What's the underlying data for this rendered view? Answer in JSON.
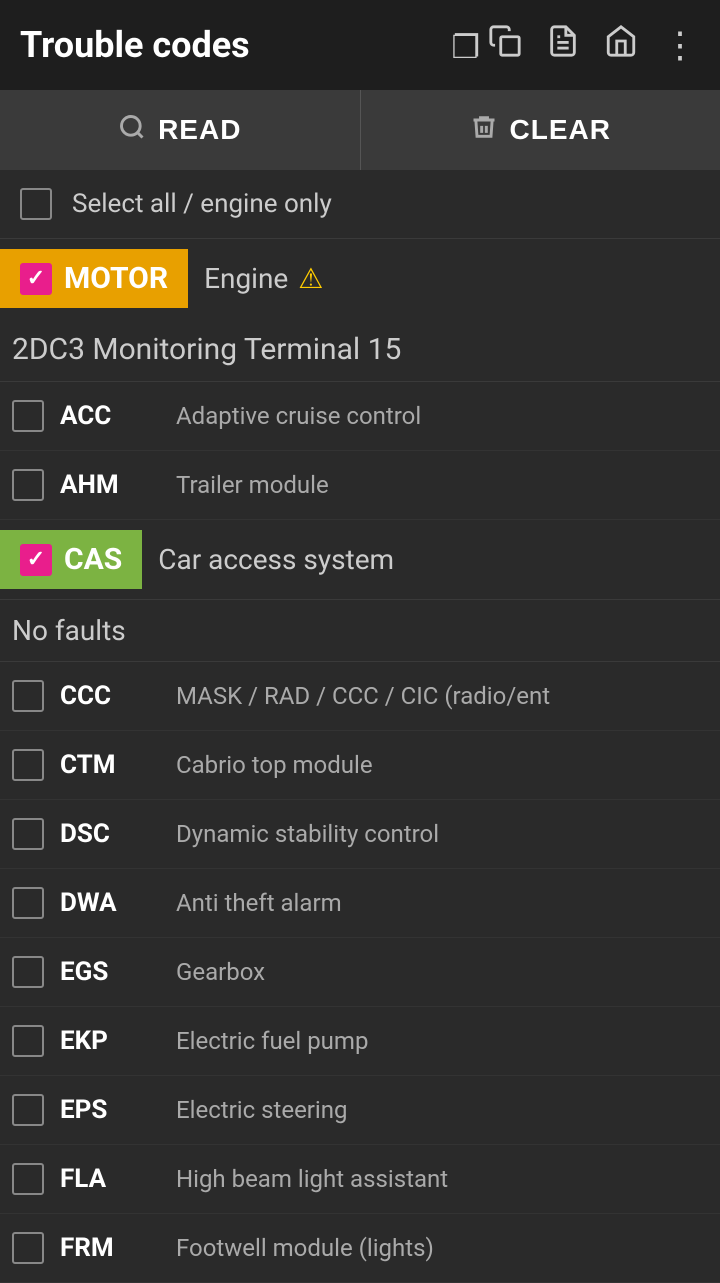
{
  "header": {
    "title": "Trouble codes",
    "icons": [
      "copy",
      "document",
      "home",
      "more"
    ]
  },
  "actions": {
    "read_label": "READ",
    "clear_label": "CLEAR"
  },
  "select_all": {
    "label": "Select all / engine only",
    "checked": false
  },
  "modules": [
    {
      "tag": "MOTOR",
      "type": "motor",
      "checked": true,
      "description": "Engine",
      "has_warning": true,
      "monitor_header": "2DC3 Monitoring Terminal 15",
      "items": [
        {
          "code": "ACC",
          "desc": "Adaptive cruise control",
          "checked": false
        },
        {
          "code": "AHM",
          "desc": "Trailer module",
          "checked": false
        }
      ]
    },
    {
      "tag": "CAS",
      "type": "cas",
      "checked": true,
      "description": "Car access system",
      "has_warning": false,
      "no_faults": "No faults",
      "items": [
        {
          "code": "CCC",
          "desc": "MASK / RAD / CCC / CIC (radio/ent",
          "checked": false
        },
        {
          "code": "CTM",
          "desc": "Cabrio top module",
          "checked": false
        },
        {
          "code": "DSC",
          "desc": "Dynamic stability control",
          "checked": false
        },
        {
          "code": "DWA",
          "desc": "Anti theft alarm",
          "checked": false
        },
        {
          "code": "EGS",
          "desc": "Gearbox",
          "checked": false
        },
        {
          "code": "EKP",
          "desc": "Electric fuel pump",
          "checked": false
        },
        {
          "code": "EPS",
          "desc": "Electric steering",
          "checked": false
        },
        {
          "code": "FLA",
          "desc": "High beam light assistant",
          "checked": false
        },
        {
          "code": "FRM",
          "desc": "Footwell module (lights)",
          "checked": false
        }
      ]
    }
  ]
}
